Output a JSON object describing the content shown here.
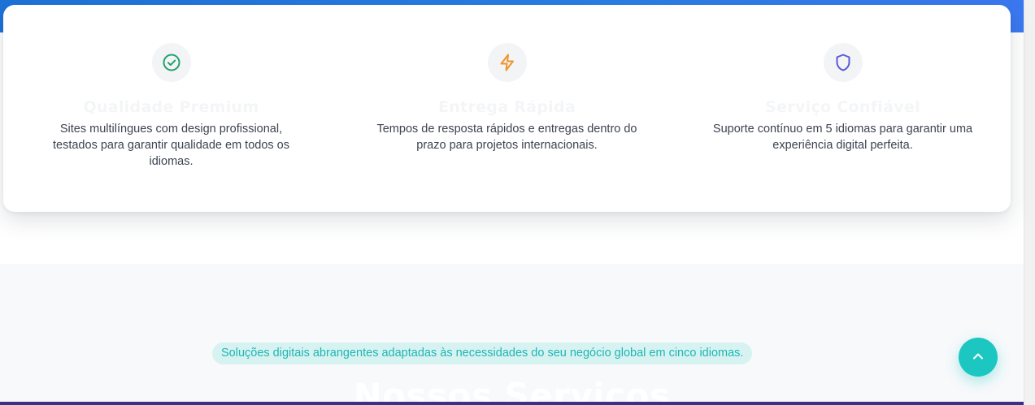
{
  "colors": {
    "accent_teal": "#1cc7c1",
    "check_icon": "#22a06b",
    "bolt_icon": "#f0932b",
    "shield_icon": "#5b5bd6",
    "header_blue": "#1e73d8"
  },
  "features": [
    {
      "icon": "check-circle-icon",
      "title": "Qualidade Premium",
      "description": "Sites multilíngues com design profissional, testados para garantir qualidade em todos os idiomas."
    },
    {
      "icon": "lightning-bolt-icon",
      "title": "Entrega Rápida",
      "description": "Tempos de resposta rápidos e entregas dentro do prazo para projetos internacionais."
    },
    {
      "icon": "shield-icon",
      "title": "Serviço Confiável",
      "description": "Suporte contínuo em 5 idiomas para garantir uma experiência digital perfeita."
    }
  ],
  "services": {
    "tagline": "Soluções digitais abrangentes adaptadas às necessidades do seu negócio global em cinco idiomas.",
    "heading": "Nossos Serviços"
  },
  "back_to_top": {
    "icon": "chevron-up-icon"
  }
}
